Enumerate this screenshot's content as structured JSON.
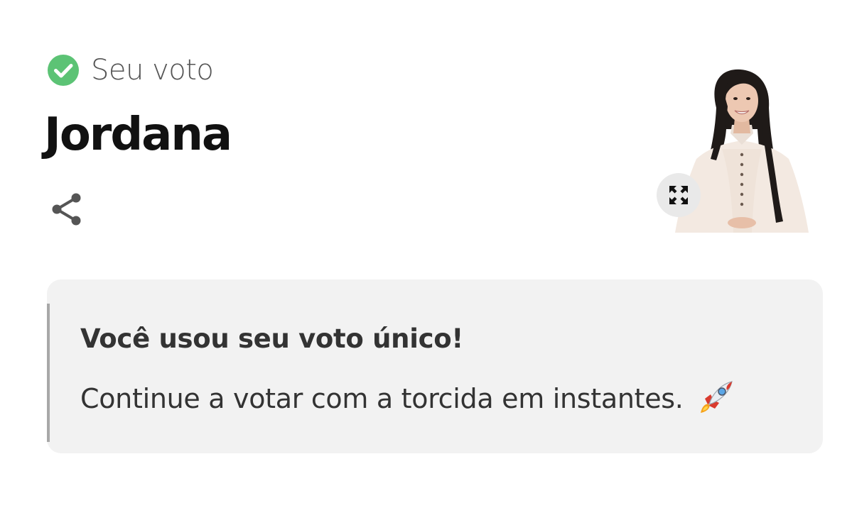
{
  "vote": {
    "status_label": "Seu voto",
    "candidate_name": "Jordana"
  },
  "icons": {
    "check": "check-circle-icon",
    "share": "share-icon",
    "expand": "expand-icon",
    "rocket": "rocket-icon"
  },
  "notice": {
    "title": "Você usou seu voto único!",
    "message": "Continue a votar com a torcida em instantes."
  },
  "colors": {
    "check_green": "#5cc375",
    "card_background": "#f2f2f2",
    "card_accent_bar": "#a8a8a8"
  }
}
